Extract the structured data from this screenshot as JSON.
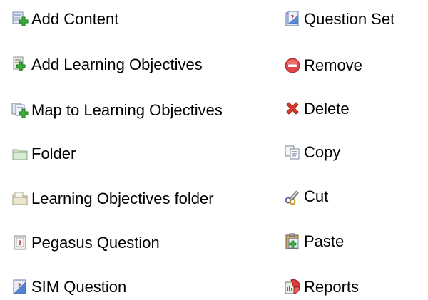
{
  "legend": {
    "left": [
      {
        "label": "Add Content",
        "icon": "add-content-icon"
      },
      {
        "label": "Add Learning Objectives",
        "icon": "add-learning-objectives-icon"
      },
      {
        "label": "Map to Learning Objectives",
        "icon": "map-learning-objectives-icon"
      },
      {
        "label": "Folder",
        "icon": "folder-icon"
      },
      {
        "label": "Learning Objectives folder",
        "icon": "learning-objectives-folder-icon"
      },
      {
        "label": "Pegasus Question",
        "icon": "pegasus-question-icon"
      },
      {
        "label": "SIM Question",
        "icon": "sim-question-icon"
      }
    ],
    "right": [
      {
        "label": "Question Set",
        "icon": "question-set-icon"
      },
      {
        "label": "Remove",
        "icon": "remove-icon"
      },
      {
        "label": "Delete",
        "icon": "delete-icon"
      },
      {
        "label": "Copy",
        "icon": "copy-icon"
      },
      {
        "label": "Cut",
        "icon": "cut-icon"
      },
      {
        "label": "Paste",
        "icon": "paste-icon"
      },
      {
        "label": "Reports",
        "icon": "reports-icon"
      }
    ]
  },
  "colors": {
    "green_plus": "#3cb23c",
    "remove_red": "#e04848",
    "delete_red": "#d83a2e",
    "folder_tan": "#e8e2c8",
    "folder_green": "#c8dfc0",
    "question_blue": "#3a6fc4",
    "reports_red": "#d93a3a"
  }
}
